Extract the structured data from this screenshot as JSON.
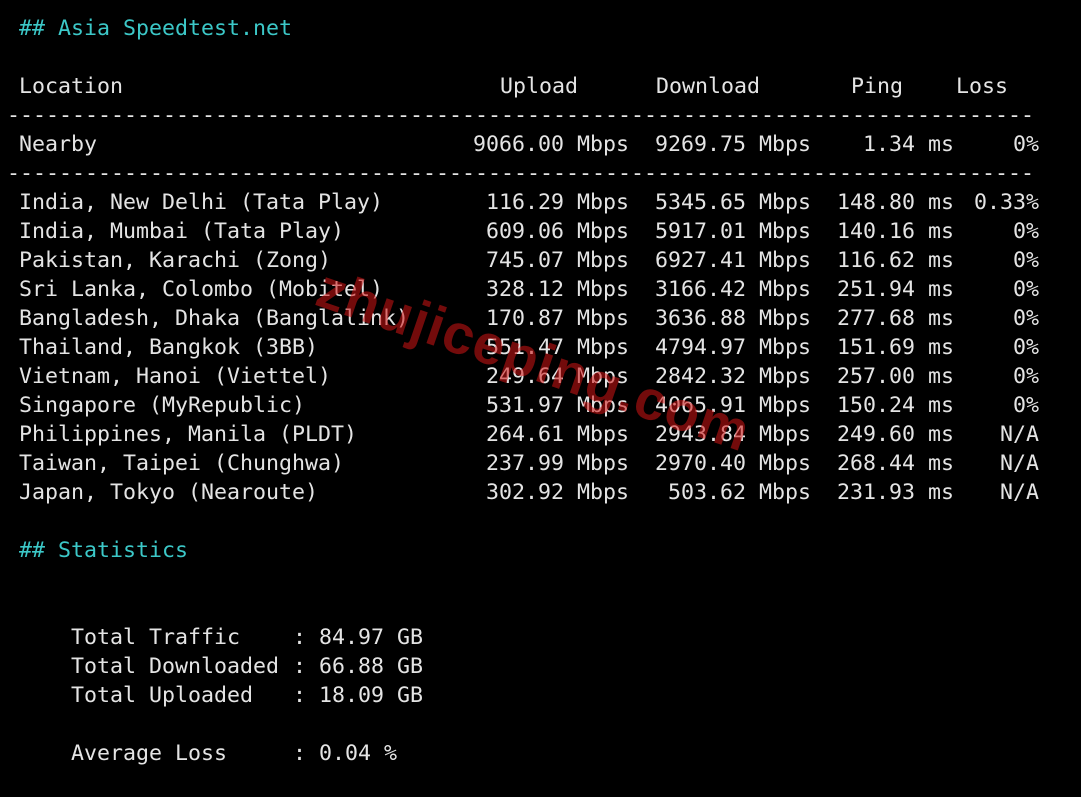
{
  "section_title": "## Asia Speedtest.net",
  "columns": {
    "location": "Location",
    "upload": "Upload",
    "download": "Download",
    "ping": "Ping",
    "loss": "Loss"
  },
  "separator": "--------------------------------------------------------------------------------",
  "nearby": {
    "location": "Nearby",
    "upload": "9066.00 Mbps",
    "download": "9269.75 Mbps",
    "ping": "1.34 ms",
    "loss": "0%"
  },
  "rows": [
    {
      "location": "India, New Delhi (Tata Play)",
      "upload": "116.29 Mbps",
      "download": "5345.65 Mbps",
      "ping": "148.80 ms",
      "loss": "0.33%"
    },
    {
      "location": "India, Mumbai (Tata Play)",
      "upload": "609.06 Mbps",
      "download": "5917.01 Mbps",
      "ping": "140.16 ms",
      "loss": "0%"
    },
    {
      "location": "Pakistan, Karachi (Zong)",
      "upload": "745.07 Mbps",
      "download": "6927.41 Mbps",
      "ping": "116.62 ms",
      "loss": "0%"
    },
    {
      "location": "Sri Lanka, Colombo (Mobitel)",
      "upload": "328.12 Mbps",
      "download": "3166.42 Mbps",
      "ping": "251.94 ms",
      "loss": "0%"
    },
    {
      "location": "Bangladesh, Dhaka (Banglalink)",
      "upload": "170.87 Mbps",
      "download": "3636.88 Mbps",
      "ping": "277.68 ms",
      "loss": "0%"
    },
    {
      "location": "Thailand, Bangkok (3BB)",
      "upload": "551.47 Mbps",
      "download": "4794.97 Mbps",
      "ping": "151.69 ms",
      "loss": "0%"
    },
    {
      "location": "Vietnam, Hanoi (Viettel)",
      "upload": "249.64 Mbps",
      "download": "2842.32 Mbps",
      "ping": "257.00 ms",
      "loss": "0%"
    },
    {
      "location": "Singapore (MyRepublic)",
      "upload": "531.97 Mbps",
      "download": "4065.91 Mbps",
      "ping": "150.24 ms",
      "loss": "0%"
    },
    {
      "location": "Philippines, Manila (PLDT)",
      "upload": "264.61 Mbps",
      "download": "2943.84 Mbps",
      "ping": "249.60 ms",
      "loss": "N/A"
    },
    {
      "location": "Taiwan, Taipei (Chunghwa)",
      "upload": "237.99 Mbps",
      "download": "2970.40 Mbps",
      "ping": "268.44 ms",
      "loss": "N/A"
    },
    {
      "location": "Japan, Tokyo (Nearoute)",
      "upload": "302.92 Mbps",
      "download": "503.62 Mbps",
      "ping": "231.93 ms",
      "loss": "N/A"
    }
  ],
  "statistics": {
    "title": "## Statistics",
    "total_traffic": {
      "label": "Total Traffic",
      "value": ": 84.97 GB"
    },
    "total_downloaded": {
      "label": "Total Downloaded",
      "value": ": 66.88 GB"
    },
    "total_uploaded": {
      "label": "Total Uploaded",
      "value": ": 18.09 GB"
    },
    "average_loss": {
      "label": "Average Loss",
      "value": ": 0.04 %"
    }
  },
  "watermark": "zhujiceping.com",
  "colors": {
    "background": "#000000",
    "text": "#e4e4e4",
    "heading": "#3cc8c8",
    "watermark": "#d21414"
  }
}
